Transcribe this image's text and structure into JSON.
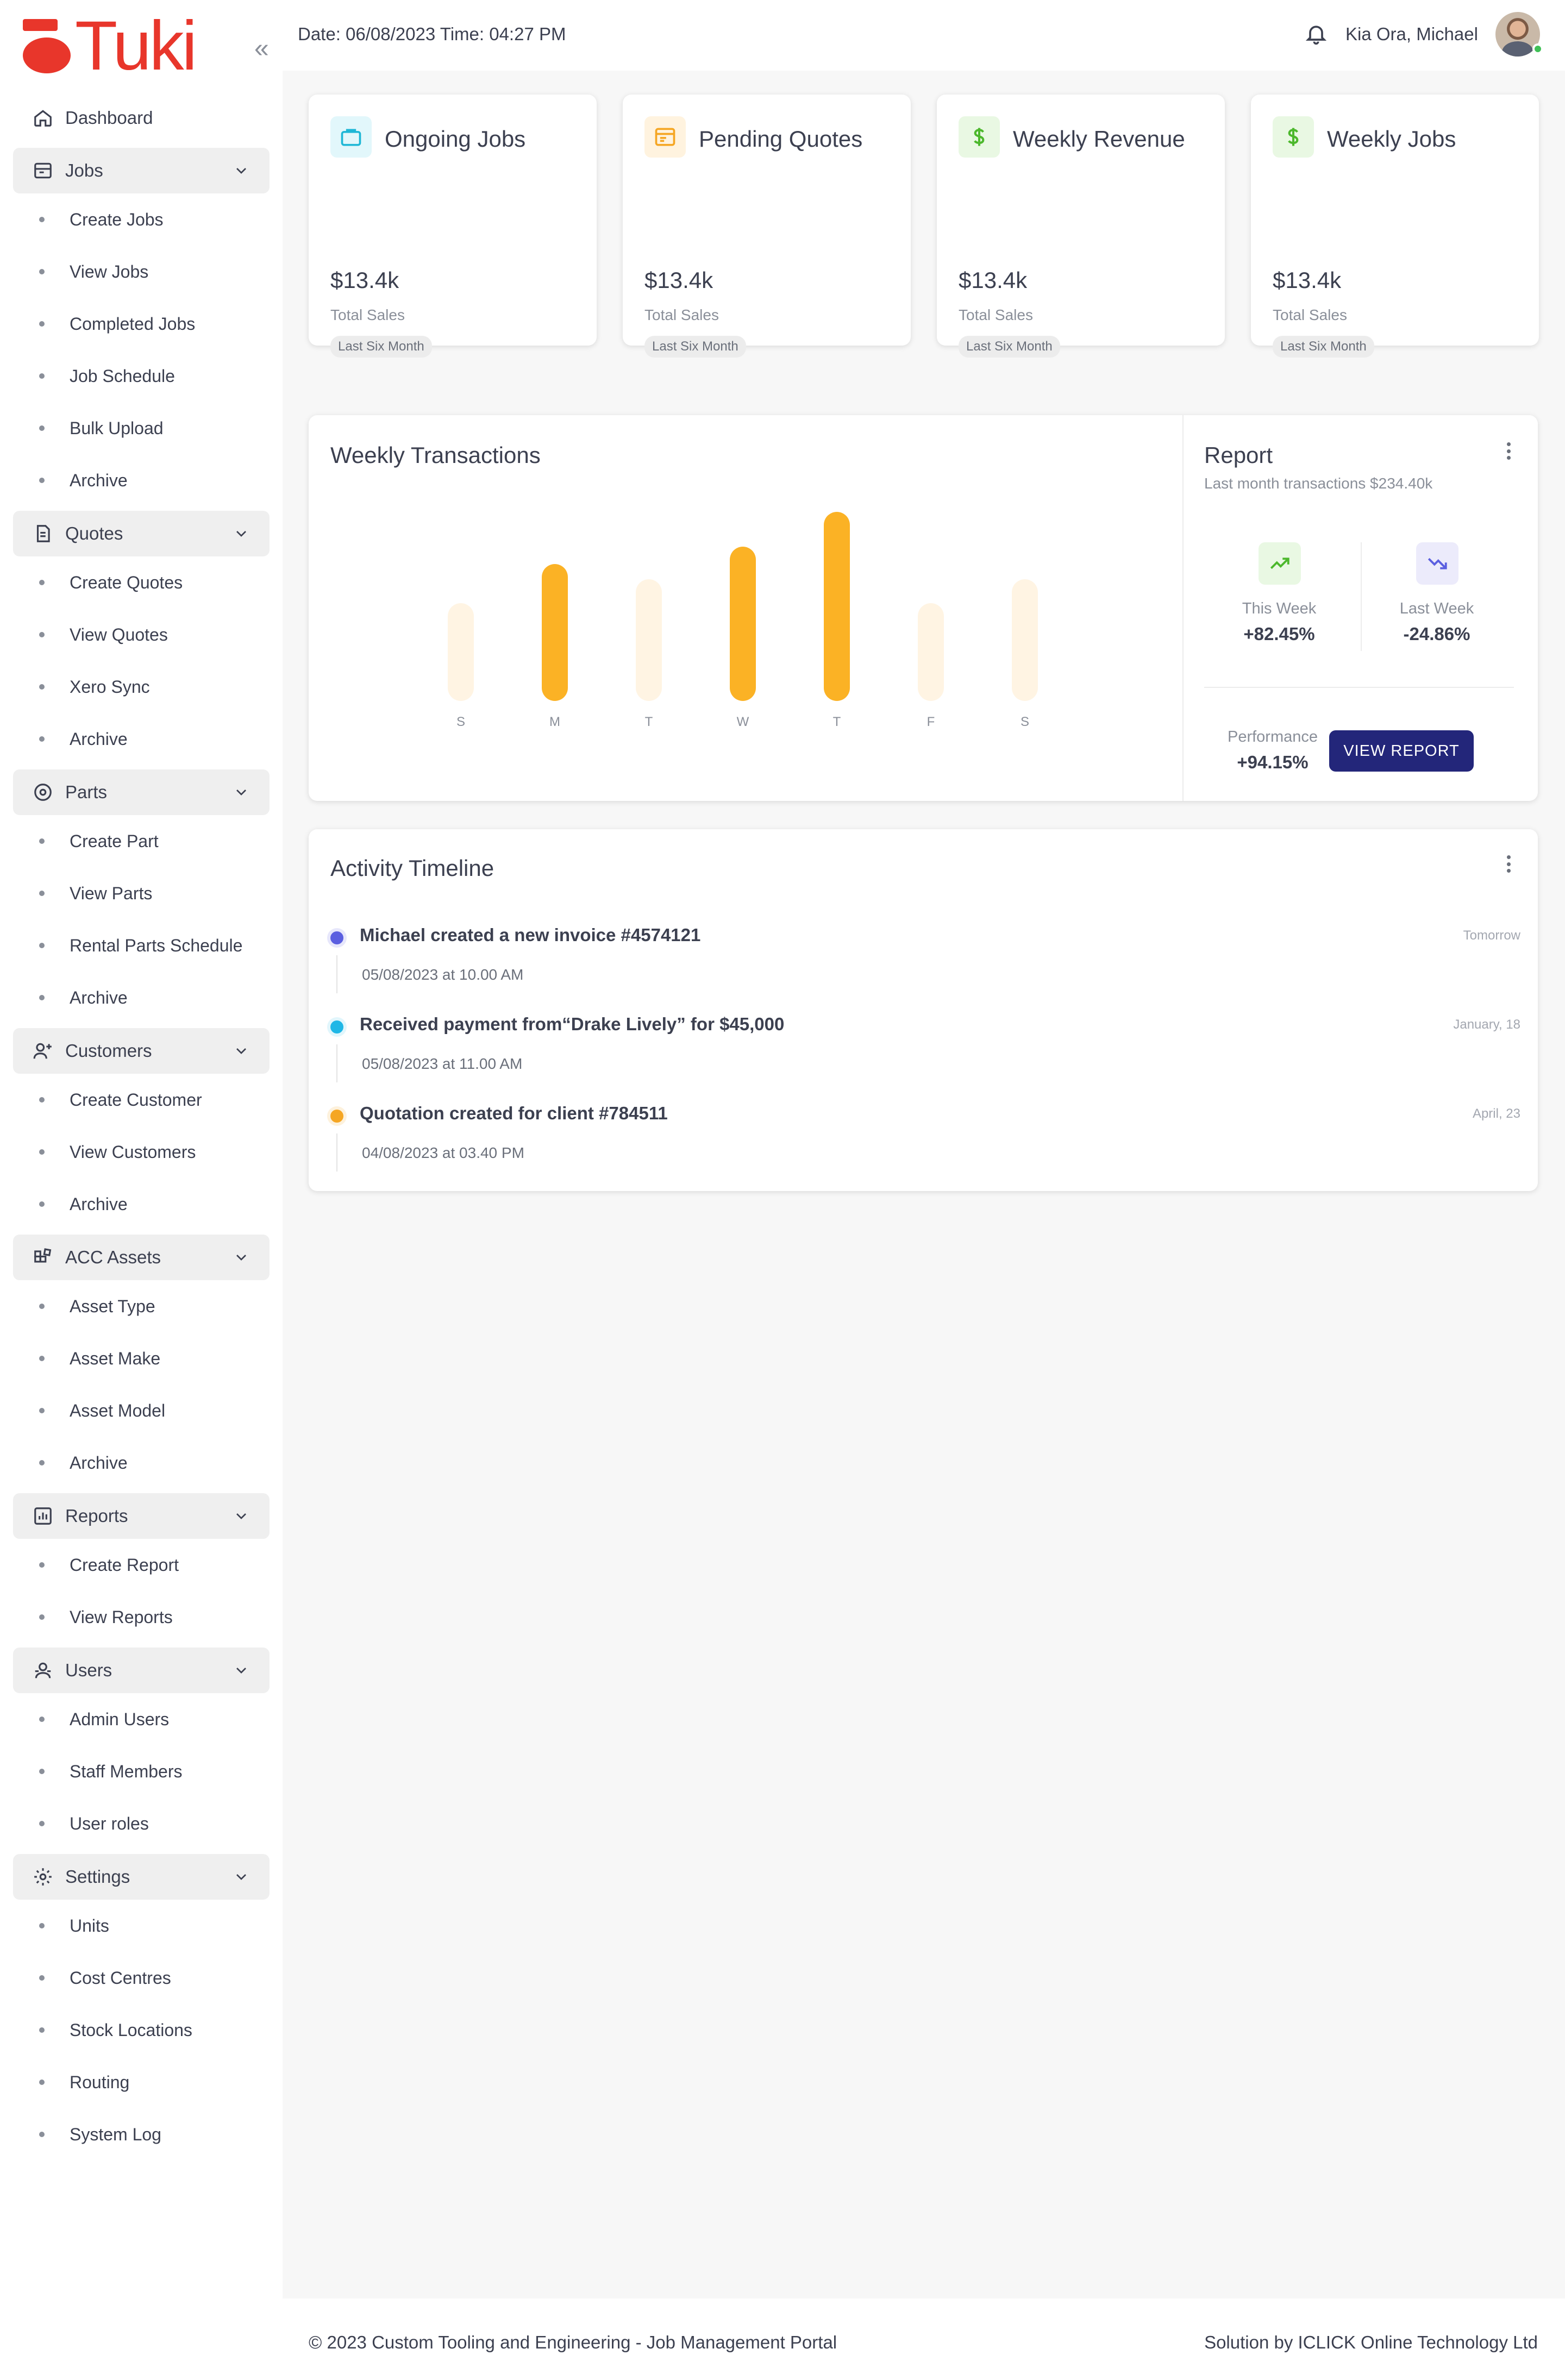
{
  "brand": {
    "name": "Tuki",
    "color": "#e8362b"
  },
  "header": {
    "datetime": "Date: 06/08/2023 Time: 04:27 PM",
    "greeting": "Kia Ora, Michael"
  },
  "sidebar": {
    "dashboard": "Dashboard",
    "groups": [
      {
        "label": "Jobs",
        "icon": "jobs-icon",
        "items": [
          "Create Jobs",
          "View Jobs",
          "Completed Jobs",
          "Job Schedule",
          "Bulk Upload",
          "Archive"
        ]
      },
      {
        "label": "Quotes",
        "icon": "quotes-icon",
        "items": [
          "Create Quotes",
          "View Quotes",
          "Xero Sync",
          "Archive"
        ]
      },
      {
        "label": "Parts",
        "icon": "parts-icon",
        "items": [
          "Create Part",
          "View Parts",
          "Rental Parts Schedule",
          "Archive"
        ]
      },
      {
        "label": "Customers",
        "icon": "customers-icon",
        "items": [
          "Create Customer",
          "View Customers",
          "Archive"
        ]
      },
      {
        "label": "ACC Assets",
        "icon": "assets-icon",
        "items": [
          "Asset Type",
          "Asset Make",
          "Asset Model",
          "Archive"
        ]
      },
      {
        "label": "Reports",
        "icon": "reports-icon",
        "items": [
          "Create Report",
          "View Reports"
        ]
      },
      {
        "label": "Users",
        "icon": "users-icon",
        "items": [
          "Admin Users",
          "Staff Members",
          "User roles"
        ]
      },
      {
        "label": "Settings",
        "icon": "settings-icon",
        "items": [
          "Units",
          "Cost Centres",
          "Stock Locations",
          "Routing",
          "System Log"
        ]
      }
    ]
  },
  "stats": [
    {
      "title": "Ongoing Jobs",
      "value": "$13.4k",
      "sub": "Total Sales",
      "pill": "Last Six Month",
      "icon": "briefcase-icon",
      "color": "#1fb7d6",
      "bg": "#e2f7fb"
    },
    {
      "title": "Pending Quotes",
      "value": "$13.4k",
      "sub": "Total Sales",
      "pill": "Last Six Month",
      "icon": "window-icon",
      "color": "#f5a623",
      "bg": "#fff3df"
    },
    {
      "title": "Weekly Revenue",
      "value": "$13.4k",
      "sub": "Total Sales",
      "pill": "Last Six Month",
      "icon": "dollar-icon",
      "color": "#4cb82c",
      "bg": "#e9f8e3"
    },
    {
      "title": "Weekly Jobs",
      "value": "$13.4k",
      "sub": "Total Sales",
      "pill": "Last Six Month",
      "icon": "dollar-icon",
      "color": "#4cb82c",
      "bg": "#e9f8e3"
    }
  ],
  "weekly": {
    "title": "Weekly Transactions"
  },
  "chart_data": {
    "type": "bar",
    "title": "Weekly Transactions",
    "categories": [
      "S",
      "M",
      "T",
      "W",
      "T",
      "F",
      "S"
    ],
    "values": [
      45,
      63,
      56,
      71,
      87,
      45,
      56
    ],
    "highlighted": [
      false,
      true,
      false,
      true,
      true,
      false,
      false
    ],
    "ylim": [
      0,
      100
    ],
    "colors": {
      "highlight": "#fbb225",
      "muted": "#fff4e3"
    }
  },
  "report": {
    "title": "Report",
    "subtitle": "Last month transactions $234.40k",
    "this_week_label": "This Week",
    "this_week_value": "+82.45%",
    "last_week_label": "Last Week",
    "last_week_value": "-24.86%",
    "performance_label": "Performance",
    "performance_value": "+94.15%",
    "button": "VIEW REPORT"
  },
  "timeline": {
    "title": "Activity Timeline",
    "items": [
      {
        "text": "Michael created a new invoice #4574121",
        "date": "05/08/2023 at 10.00 AM",
        "when": "Tomorrow",
        "color": "#5b5fe0"
      },
      {
        "text": "Received payment from“Drake Lively” for $45,000",
        "date": "05/08/2023 at 11.00 AM",
        "when": "January, 18",
        "color": "#1fb7e6"
      },
      {
        "text": "Quotation created for client #784511",
        "date": "04/08/2023 at 03.40 PM",
        "when": "April, 23",
        "color": "#f5a623"
      }
    ]
  },
  "footer": {
    "left": "© 2023 Custom Tooling and Engineering - Job Management Portal",
    "right": "Solution by ICLICK Online Technology Ltd"
  }
}
